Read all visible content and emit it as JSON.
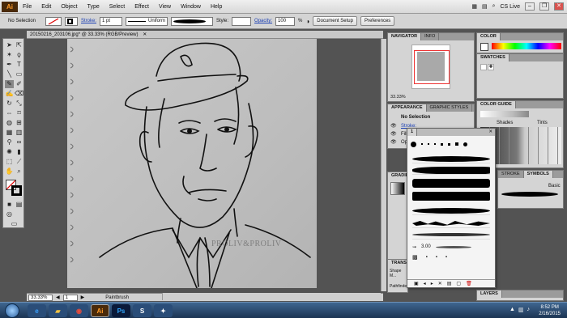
{
  "menu": {
    "app_logo": "Ai",
    "items": [
      "File",
      "Edit",
      "Object",
      "Type",
      "Select",
      "Effect",
      "View",
      "Window",
      "Help"
    ],
    "cs_live": "CS Live"
  },
  "control": {
    "selection": "No Selection",
    "stroke_label": "Stroke:",
    "stroke_value": "1 pt",
    "profile": "Uniform",
    "style_label": "Style:",
    "opacity_label": "Opacity:",
    "opacity_value": "100",
    "opacity_unit": "%",
    "doc_setup": "Document Setup",
    "preferences": "Preferences"
  },
  "document": {
    "tab_title": "20150216_203106.jpg* @ 33.33% (RGB/Preview)",
    "watermark": "PROLIV&PROLIV",
    "zoom": "33.33%",
    "page": "1",
    "tool_status": "Paintbrush"
  },
  "panels": {
    "navigator_tabs": [
      "NAVIGATOR",
      "INFO"
    ],
    "navigator_zoom": "33.33%",
    "color_tab": "COLOR",
    "swatches_tab": "SWATCHES",
    "appearance_tabs": [
      "APPEARANCE",
      "GRAPHIC STYLES"
    ],
    "appearance_selection": "No Selection",
    "appearance_stroke": "Stroke:",
    "appearance_fill": "Fill:",
    "appearance_opacity": "Opacity:",
    "color_guide_tab": "COLOR GUIDE",
    "shades": "Shades",
    "tints": "Tints",
    "gradient_tab": "GRADIENT",
    "stroke_tab": "STROKE",
    "symbols_tab": "SYMBOLS",
    "basic_label": "Basic",
    "transform_tab": "TRANSF...",
    "shape_mode": "Shape M...",
    "pathfinder": "Pathfinde...",
    "layers_tab": "LAYERS"
  },
  "brushes": {
    "tab": "1",
    "stroke_size": "3.00"
  },
  "taskbar": {
    "time": "8:52 PM",
    "date": "2/16/2015",
    "apps": [
      "Ai",
      "Ps",
      "S"
    ]
  },
  "colors": {
    "accent": "#3b6ea5",
    "ai_brand": "#ff9b2a",
    "ps_brand": "#31a8ff"
  }
}
